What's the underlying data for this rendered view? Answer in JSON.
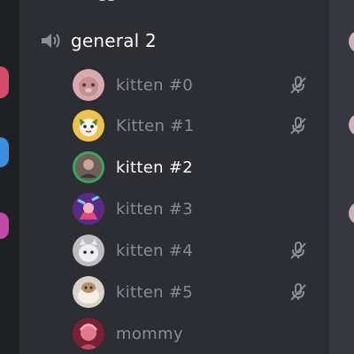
{
  "channel": {
    "name": "general 2",
    "icon": "speaker-icon"
  },
  "users": [
    {
      "name": "kitten #0",
      "muted": true,
      "active": false
    },
    {
      "name": "Kitten #1",
      "muted": true,
      "active": false
    },
    {
      "name": "kitten #2",
      "muted": false,
      "active": true
    },
    {
      "name": "kitten #3",
      "muted": false,
      "active": false
    },
    {
      "name": "kitten #4",
      "muted": true,
      "active": false
    },
    {
      "name": "kitten #5",
      "muted": true,
      "active": false
    },
    {
      "name": "mommy",
      "muted": false,
      "active": false
    }
  ],
  "colors": {
    "background": "#2d2e34",
    "active_text": "#ffffff",
    "inactive_text": "#8a8b92",
    "speaking_ring": "#3ba55d"
  }
}
